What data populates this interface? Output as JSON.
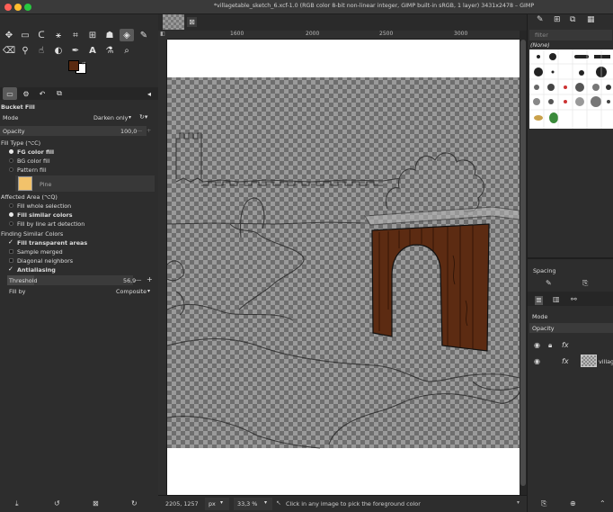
{
  "window": {
    "title": "*villagetable_sketch_6.xcf-1.0 (RGB color 8-bit non-linear integer, GIMP built-in sRGB, 1 layer) 3431x2478 – GIMP"
  },
  "colors": {
    "foreground": "#5a2a10",
    "background": "#ffffff",
    "pattern_swatch": "#f2c26b",
    "wood": "#5c2b12",
    "accent": "#e8e8e8"
  },
  "tool_options": {
    "title": "Bucket Fill",
    "mode_label": "Mode",
    "mode_value": "Darken only",
    "opacity_label": "Opacity",
    "opacity_value": "100,0",
    "fill_type_heading": "Fill Type  (⌥C)",
    "fill_types": [
      "FG color fill",
      "BG color fill",
      "Pattern fill"
    ],
    "fill_type_selected": "FG color fill",
    "pattern_name": "Pine",
    "affected_area_heading": "Affected Area  (⌥Q)",
    "affected_areas": [
      "Fill whole selection",
      "Fill similar colors",
      "Fill by line art detection"
    ],
    "affected_area_selected": "Fill similar colors",
    "finding_heading": "Finding Similar Colors",
    "options": [
      {
        "label": "Fill transparent areas",
        "checked": true
      },
      {
        "label": "Sample merged",
        "checked": false
      },
      {
        "label": "Diagonal neighbors",
        "checked": false
      },
      {
        "label": "Antialiasing",
        "checked": true
      }
    ],
    "threshold_label": "Threshold",
    "threshold_value": "56,9",
    "fill_by_label": "Fill by",
    "fill_by_value": "Composite"
  },
  "rulers": {
    "top": [
      "1600",
      "2000",
      "2500",
      "3000"
    ]
  },
  "status": {
    "coords": "2205, 1257",
    "unit": "px",
    "zoom": "33,3 %",
    "message": "Click in any image to pick the foreground color"
  },
  "right_dock": {
    "filter_placeholder": "filter",
    "brush_name": "(None)",
    "spacing_label": "Spacing",
    "mode_label": "Mode",
    "opacity_label": "Opacity",
    "layer_name": "village"
  }
}
